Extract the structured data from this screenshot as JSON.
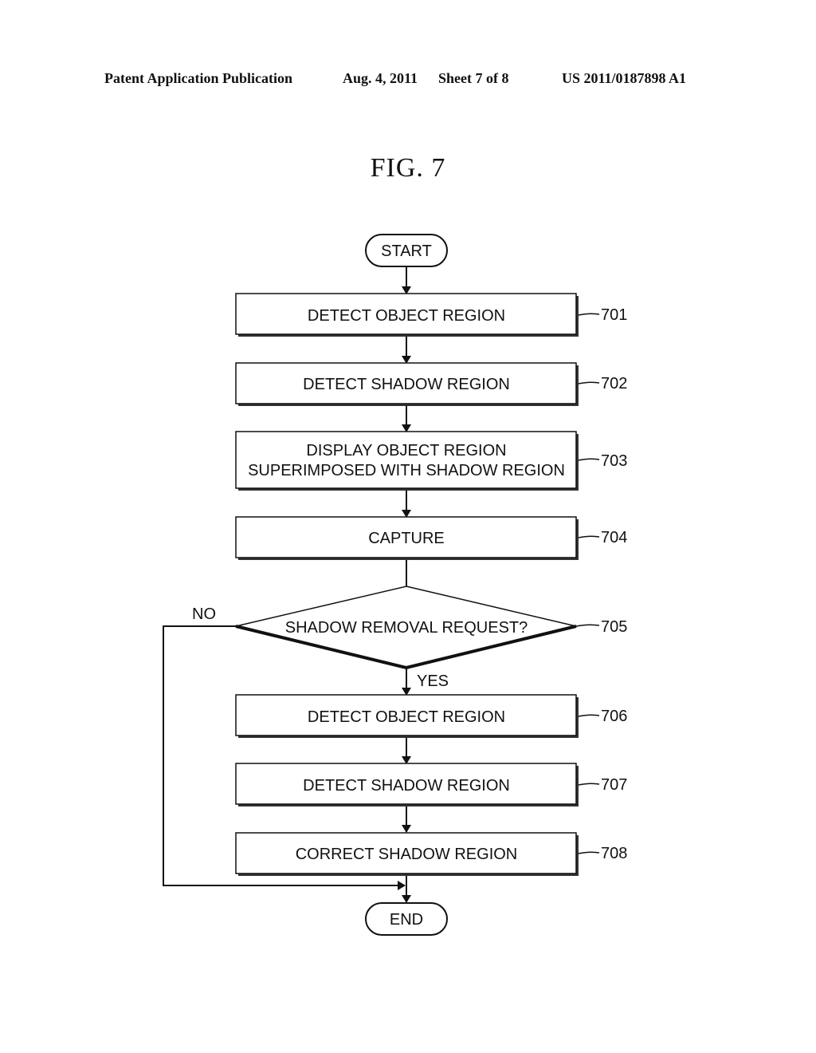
{
  "header": {
    "publication": "Patent Application Publication",
    "date": "Aug. 4, 2011",
    "sheet": "Sheet 7 of 8",
    "number": "US 2011/0187898 A1"
  },
  "figure": {
    "title": "FIG. 7"
  },
  "flowchart": {
    "start": "START",
    "end": "END",
    "steps": [
      {
        "ref": "701",
        "lines": [
          "DETECT OBJECT REGION"
        ]
      },
      {
        "ref": "702",
        "lines": [
          "DETECT SHADOW REGION"
        ]
      },
      {
        "ref": "703",
        "lines": [
          "DISPLAY OBJECT REGION",
          "SUPERIMPOSED WITH SHADOW REGION"
        ]
      },
      {
        "ref": "704",
        "lines": [
          "CAPTURE"
        ]
      }
    ],
    "decision": {
      "ref": "705",
      "text": "SHADOW REMOVAL REQUEST?",
      "yes": "YES",
      "no": "NO"
    },
    "steps_after": [
      {
        "ref": "706",
        "lines": [
          "DETECT OBJECT REGION"
        ]
      },
      {
        "ref": "707",
        "lines": [
          "DETECT SHADOW REGION"
        ]
      },
      {
        "ref": "708",
        "lines": [
          "CORRECT SHADOW REGION"
        ]
      }
    ]
  }
}
